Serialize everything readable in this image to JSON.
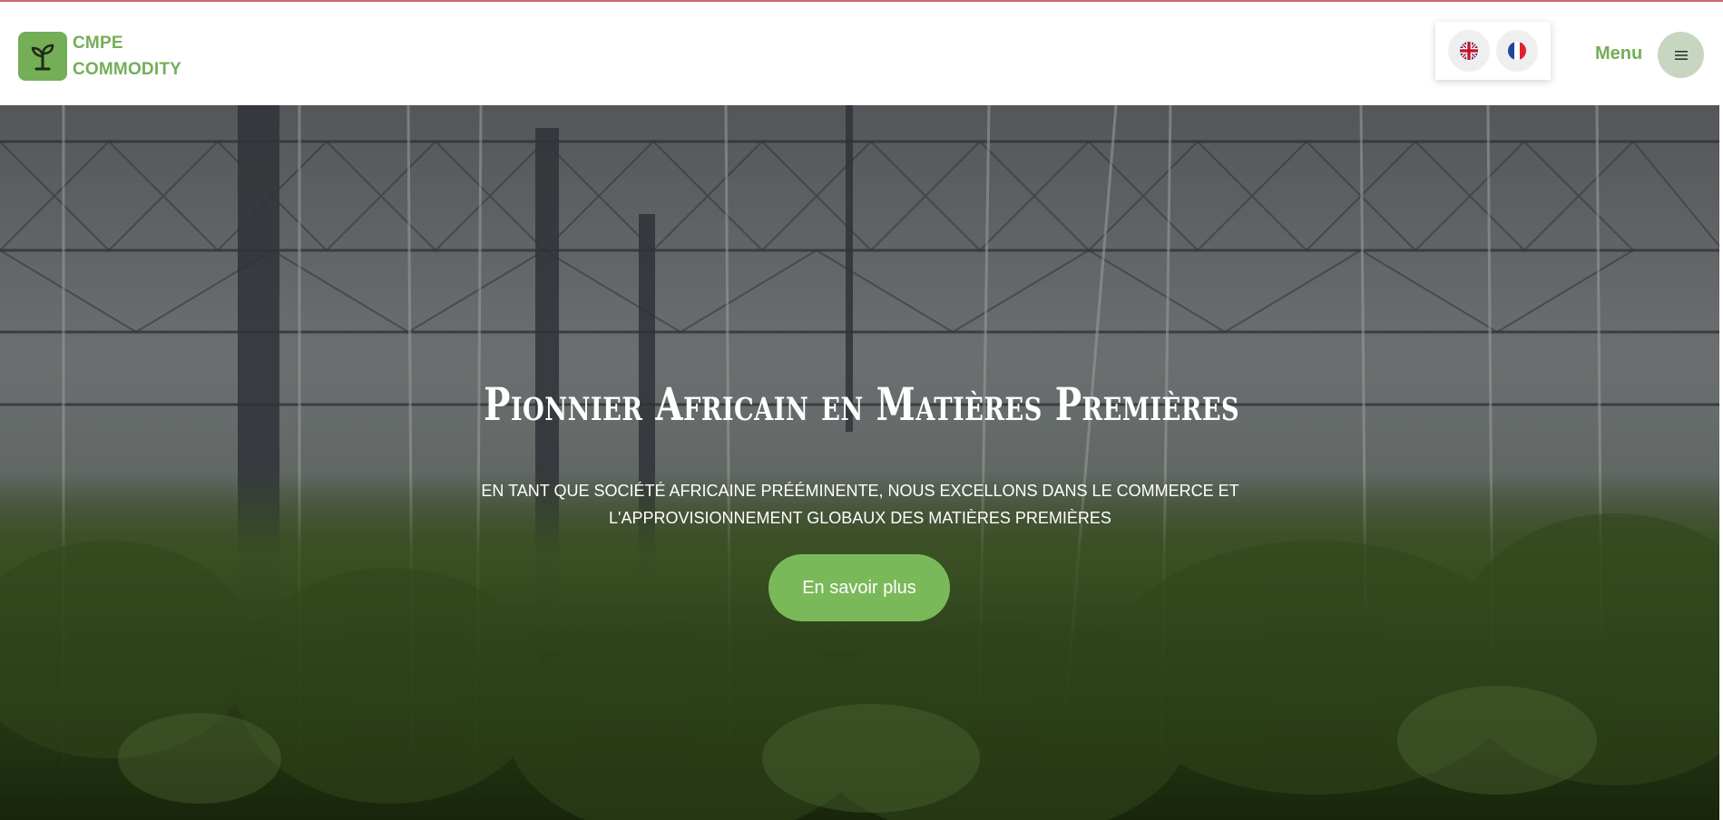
{
  "brand": {
    "line1": "CMPE",
    "line2": "COMMODITY",
    "icon": "sprout-icon"
  },
  "languages": [
    {
      "name": "English",
      "icon": "uk-flag-icon"
    },
    {
      "name": "Français",
      "icon": "france-flag-icon"
    }
  ],
  "nav": {
    "menu_label": "Menu",
    "menu_icon": "hamburger-icon"
  },
  "hero": {
    "title": "Pionnier Africain en Matières Premières",
    "subtitle_line1": "EN TANT QUE SOCIÉTÉ AFRICAINE PRÉÉMINENTE, NOUS EXCELLONS DANS LE COMMERCE ET",
    "subtitle_line2": "L'APPROVISIONNEMENT GLOBAUX DES MATIÈRES PREMIÈRES",
    "cta_label": "En savoir plus"
  },
  "colors": {
    "brand_green": "#74ae57",
    "cta_green": "#7ab95a",
    "menu_button": "#c7d6c0"
  }
}
